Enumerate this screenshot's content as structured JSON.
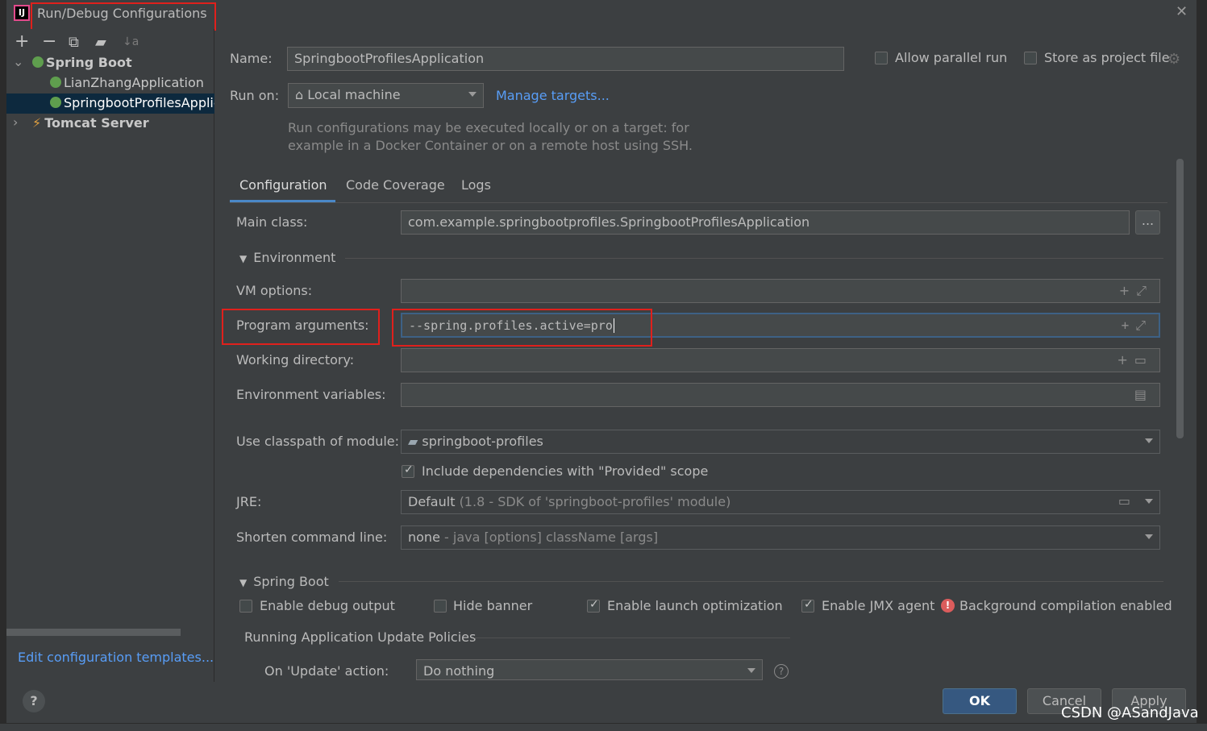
{
  "window": {
    "title": "Run/Debug Configurations"
  },
  "toolbar": {
    "add": "+",
    "remove": "−",
    "copy": "⧉",
    "folder": "▰",
    "sort": "↓a"
  },
  "tree": {
    "spring_boot": "Spring Boot",
    "item1": "LianZhangApplication",
    "item2": "SpringbootProfilesApplic",
    "tomcat": "Tomcat Server"
  },
  "form": {
    "name_label": "Name:",
    "name_value": "SpringbootProfilesApplication",
    "allow_parallel": "Allow parallel run",
    "store_project": "Store as project file",
    "run_on_label": "Run on:",
    "run_on_value": "Local machine",
    "manage_targets": "Manage targets...",
    "hint_line1": "Run configurations may be executed locally or on a target: for",
    "hint_line2": "example in a Docker Container or on a remote host using SSH."
  },
  "tabs": [
    "Configuration",
    "Code Coverage",
    "Logs"
  ],
  "config": {
    "main_class_label": "Main class:",
    "main_class_value": "com.example.springbootprofiles.SpringbootProfilesApplication",
    "environment": "Environment",
    "vm_options_label": "VM options:",
    "program_args_label": "Program arguments:",
    "program_args_value": "--spring.profiles.active=pro",
    "working_dir_label": "Working directory:",
    "env_vars_label": "Environment variables:",
    "classpath_label": "Use classpath of module:",
    "classpath_value": "springboot-profiles",
    "include_deps": "Include dependencies with \"Provided\" scope",
    "jre_label": "JRE:",
    "jre_value": "Default",
    "jre_detail": "(1.8 - SDK of 'springboot-profiles' module)",
    "shorten_label": "Shorten command line:",
    "shorten_value": "none",
    "shorten_detail": "- java [options] className [args]",
    "spring_boot_section": "Spring Boot",
    "debug_output": "Enable debug output",
    "hide_banner": "Hide banner",
    "launch_opt": "Enable launch optimization",
    "jmx_agent": "Enable JMX agent",
    "bg_compilation": "Background compilation enabled",
    "update_policies": "Running Application Update Policies",
    "on_update_label": "On 'Update' action:",
    "on_update_value": "Do nothing"
  },
  "footer": {
    "edit_templates": "Edit configuration templates...",
    "ok": "OK",
    "cancel": "Cancel",
    "apply": "Apply",
    "help": "?"
  },
  "watermark": "CSDN @ASandJava"
}
